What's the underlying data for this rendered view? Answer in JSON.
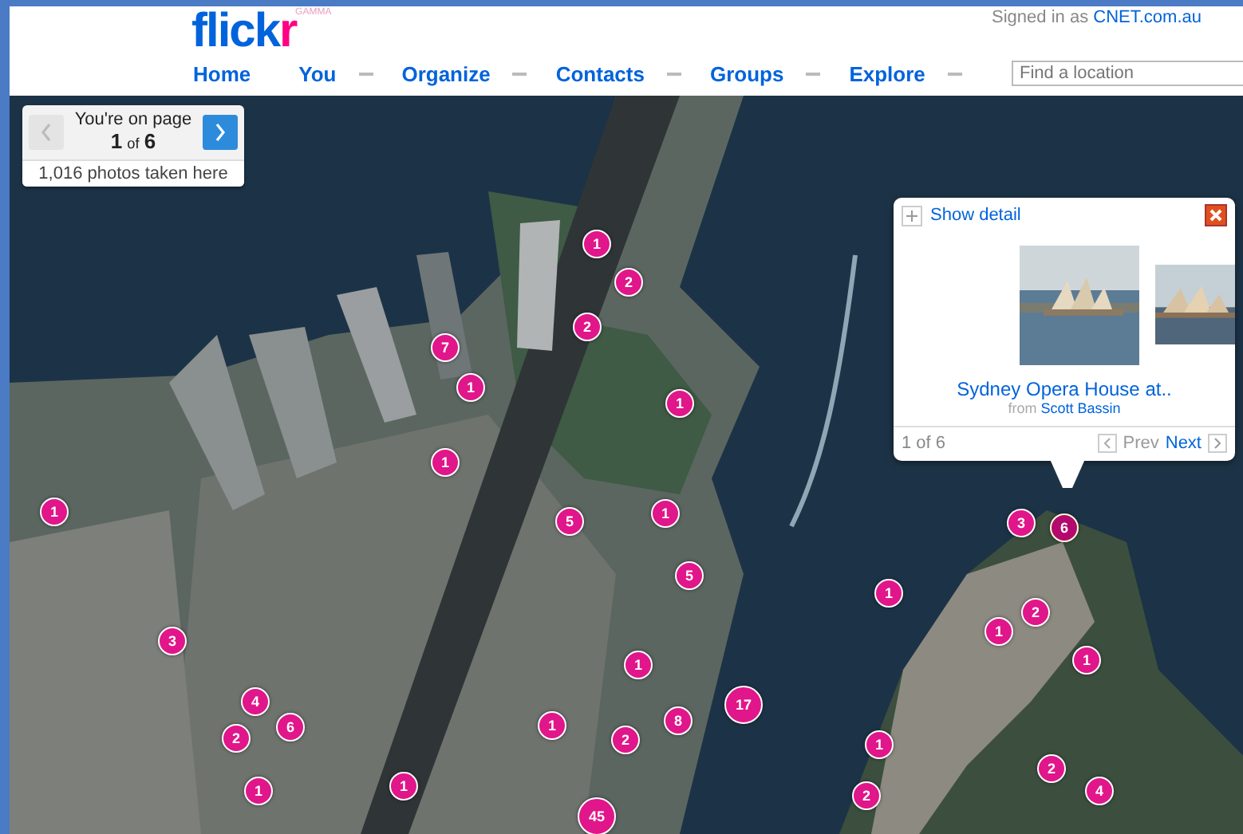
{
  "header": {
    "logo": {
      "main": "flick",
      "accent": "r",
      "badge": "GAMMA"
    },
    "signed_in": {
      "label": "Signed in as",
      "user": "CNET.com.au"
    },
    "nav": [
      {
        "label": "Home",
        "menu": false
      },
      {
        "label": "You",
        "menu": true
      },
      {
        "label": "Organize",
        "menu": true
      },
      {
        "label": "Contacts",
        "menu": true
      },
      {
        "label": "Groups",
        "menu": true
      },
      {
        "label": "Explore",
        "menu": true
      }
    ],
    "search": {
      "placeholder": "Find a location"
    }
  },
  "pager": {
    "label": "You're on page",
    "page": "1",
    "of": "of",
    "total": "6",
    "summary": "1,016 photos taken here",
    "prev_disabled": true,
    "next_disabled": false
  },
  "popup": {
    "show_detail": "Show detail",
    "caption": "Sydney Opera House at..",
    "from": "from",
    "author": "Scott Bassin",
    "position": "1 of 6",
    "prev": "Prev",
    "next": "Next",
    "prev_disabled": true
  },
  "markers": [
    {
      "count": "1",
      "selected": false
    },
    {
      "count": "2",
      "selected": false
    },
    {
      "count": "2",
      "selected": false
    },
    {
      "count": "7",
      "selected": false
    },
    {
      "count": "1",
      "selected": false
    },
    {
      "count": "1",
      "selected": false
    },
    {
      "count": "1",
      "selected": false
    },
    {
      "count": "1",
      "selected": false
    },
    {
      "count": "5",
      "selected": false
    },
    {
      "count": "1",
      "selected": false
    },
    {
      "count": "3",
      "selected": false
    },
    {
      "count": "6",
      "selected": true
    },
    {
      "count": "5",
      "selected": false
    },
    {
      "count": "1",
      "selected": false
    },
    {
      "count": "2",
      "selected": false
    },
    {
      "count": "3",
      "selected": false
    },
    {
      "count": "1",
      "selected": false
    },
    {
      "count": "1",
      "selected": false
    },
    {
      "count": "1",
      "selected": false
    },
    {
      "count": "4",
      "selected": false
    },
    {
      "count": "17",
      "selected": false
    },
    {
      "count": "6",
      "selected": false
    },
    {
      "count": "1",
      "selected": false
    },
    {
      "count": "8",
      "selected": false
    },
    {
      "count": "2",
      "selected": false
    },
    {
      "count": "2",
      "selected": false
    },
    {
      "count": "1",
      "selected": false
    },
    {
      "count": "2",
      "selected": false
    },
    {
      "count": "1",
      "selected": false
    },
    {
      "count": "1",
      "selected": false
    },
    {
      "count": "2",
      "selected": false
    },
    {
      "count": "4",
      "selected": false
    },
    {
      "count": "45",
      "selected": false
    }
  ]
}
